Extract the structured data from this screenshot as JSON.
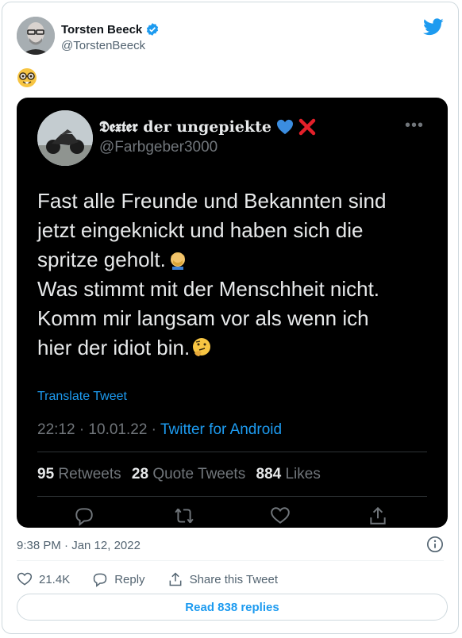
{
  "colors": {
    "accent": "#1d9bf0",
    "text": "#0f1419",
    "secondary": "#536471",
    "embed_background": "#000000",
    "embed_text": "#e7e9ea",
    "embed_secondary": "#71767b"
  },
  "tweet": {
    "author_name": "Torsten Beeck",
    "author_handle": "@TorstenBeeck",
    "verified_icon": "verified-badge-icon",
    "logo_icon": "twitter-bird-icon",
    "emoji_icon": "nerd-face-emoji",
    "timestamp": "9:38 PM · Jan 12, 2022",
    "likes": "21.4K",
    "reply_label": "Reply",
    "share_label": "Share this Tweet",
    "read_replies": "Read 838 replies"
  },
  "embedded": {
    "name": "𝕯𝖊𝖝𝖙𝖊𝖗 der ungepiekte",
    "name_emojis": [
      "blue-heart-emoji",
      "red-x-emoji"
    ],
    "handle": "@Farbgeber3000",
    "body_lines": [
      "Fast alle Freunde und Bekannten sind",
      "jetzt eingeknickt und haben sich die",
      "spritze geholt.",
      "Was stimmt mit der Menschheit nicht.",
      "Komm mir langsam vor als wenn ich",
      "hier der idiot bin."
    ],
    "translate_label": "Translate Tweet",
    "time_date": "22:12 · 10.01.22 · ",
    "source": "Twitter for Android",
    "retweets_count": "95",
    "retweets_label": "Retweets",
    "quotes_count": "28",
    "quotes_label": "Quote Tweets",
    "likes_count": "884",
    "likes_label": "Likes"
  }
}
